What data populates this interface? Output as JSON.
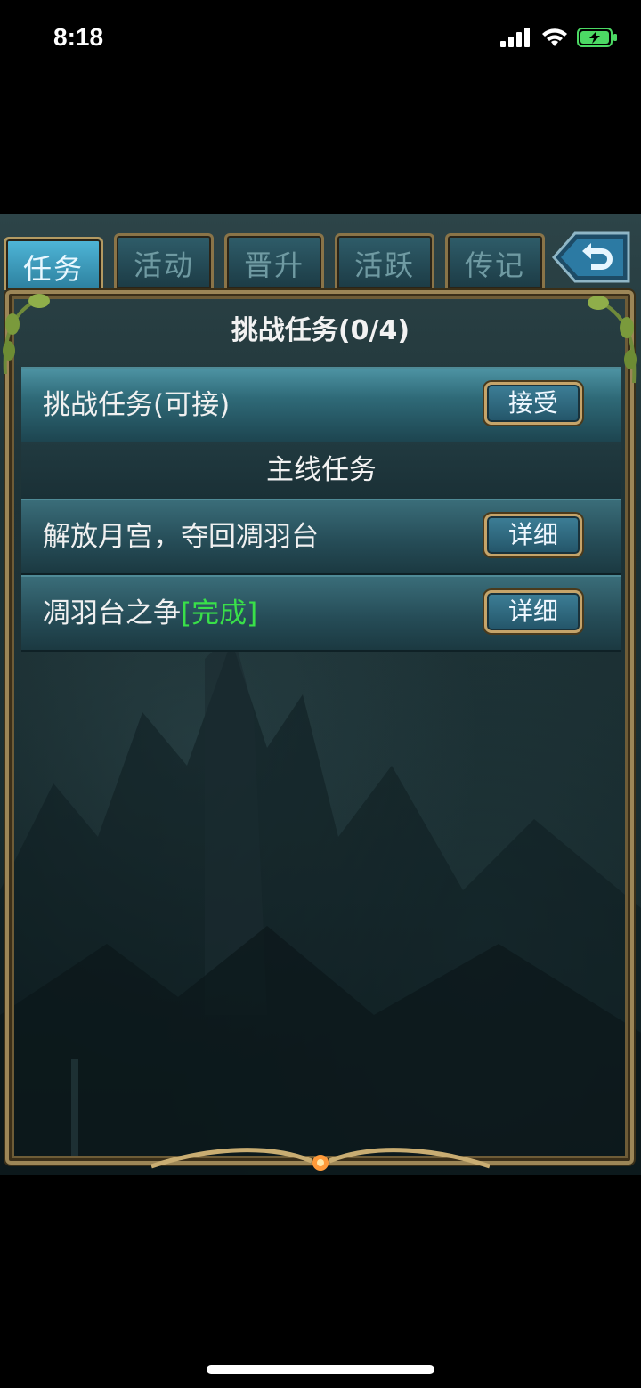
{
  "status_bar": {
    "time": "8:18",
    "icons": [
      "signal-icon",
      "wifi-icon",
      "battery-charging-icon"
    ],
    "battery_color": "#4cd964"
  },
  "tabs": [
    {
      "label": "任务",
      "active": true
    },
    {
      "label": "活动",
      "active": false
    },
    {
      "label": "晋升",
      "active": false
    },
    {
      "label": "活跃",
      "active": false
    },
    {
      "label": "传记",
      "active": false
    }
  ],
  "back_button": {
    "icon": "back-arrow-icon"
  },
  "panel": {
    "title": "挑战任务(0/4)",
    "challenge_row": {
      "label": "挑战任务(可接)",
      "button": "接受"
    },
    "section_header": "主线任务",
    "quests": [
      {
        "label": "解放月宫，夺回凋羽台",
        "status": "",
        "button": "详细"
      },
      {
        "label": "凋羽台之争",
        "status": "[完成]",
        "button": "详细"
      }
    ]
  },
  "colors": {
    "accent_gold": "#9c8657",
    "tab_active": "#4fb6d8",
    "complete_green": "#39e049"
  }
}
